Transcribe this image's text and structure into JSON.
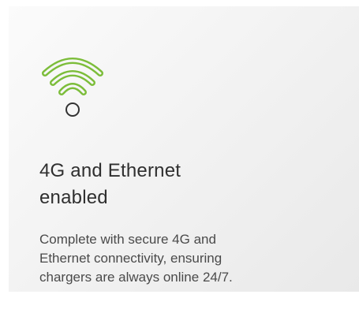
{
  "feature_card": {
    "icon": "wifi-icon",
    "icon_color": "#7cbd3a",
    "title_line1": "4G and Ethernet",
    "title_line2": "enabled",
    "description_line1": "Complete with secure 4G and",
    "description_line2": "Ethernet connectivity, ensuring",
    "description_line3": "chargers are always online 24/7."
  }
}
